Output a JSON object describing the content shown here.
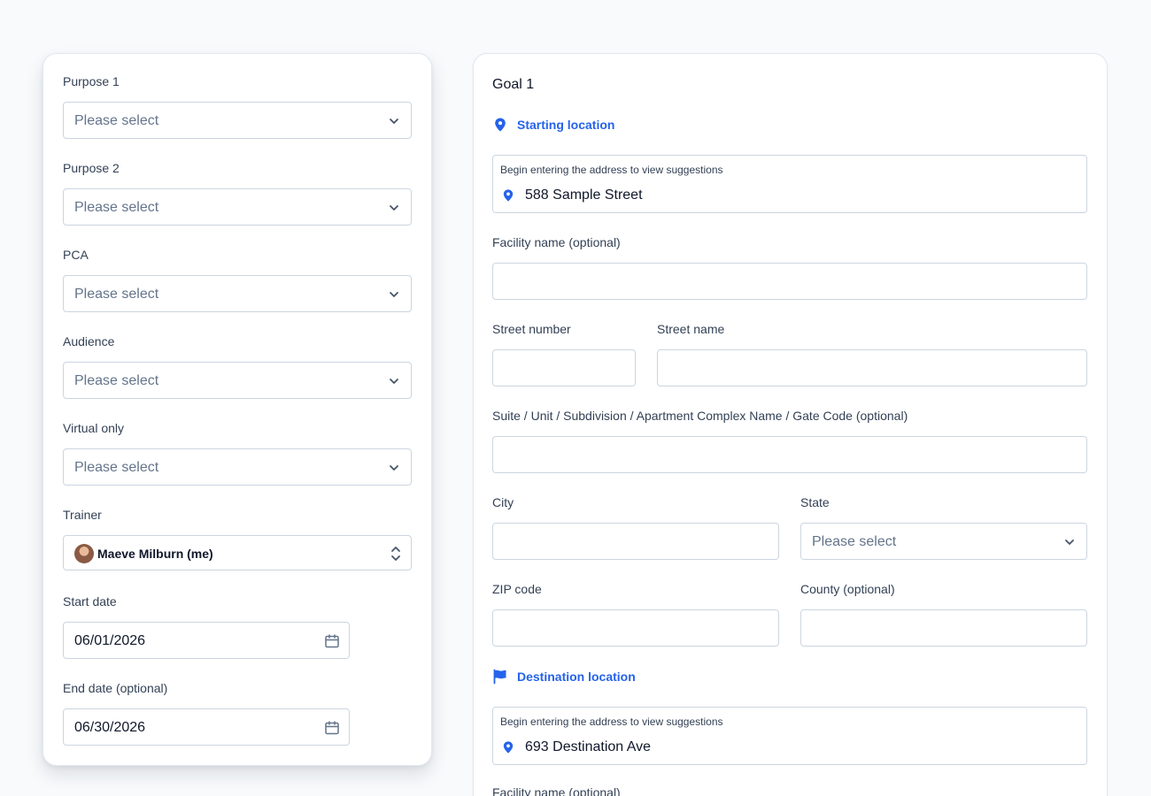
{
  "left_panel": {
    "fields": [
      {
        "label": "Purpose 1",
        "value": "Please select"
      },
      {
        "label": "Purpose 2",
        "value": "Please select"
      },
      {
        "label": "PCA",
        "value": "Please select"
      },
      {
        "label": "Audience",
        "value": "Please select"
      },
      {
        "label": "Virtual only",
        "value": "Please select"
      }
    ],
    "trainer": {
      "label": "Trainer",
      "value": "Maeve Milburn (me)"
    },
    "start_date": {
      "label": "Start date",
      "value": "06/01/2026"
    },
    "end_date": {
      "label": "End date (optional)",
      "value": "06/30/2026"
    }
  },
  "goal": {
    "title": "Goal 1",
    "starting": {
      "heading": "Starting location",
      "address_hint": "Begin entering the address to view suggestions",
      "address_value": "588 Sample Street"
    },
    "facility_label": "Facility name (optional)",
    "street_number_label": "Street number",
    "street_name_label": "Street name",
    "suite_label": "Suite / Unit / Subdivision / Apartment Complex Name / Gate Code (optional)",
    "city_label": "City",
    "state_label": "State",
    "state_value": "Please select",
    "zip_label": "ZIP code",
    "county_label": "County (optional)",
    "destination": {
      "heading": "Destination location",
      "address_hint": "Begin entering the address to view suggestions",
      "address_value": "693 Destination Ave"
    },
    "dest_facility_label": "Facility name (optional)"
  },
  "colors": {
    "accent": "#2563eb",
    "border": "#cbd5e1",
    "page_bg": "#f8fafc"
  }
}
